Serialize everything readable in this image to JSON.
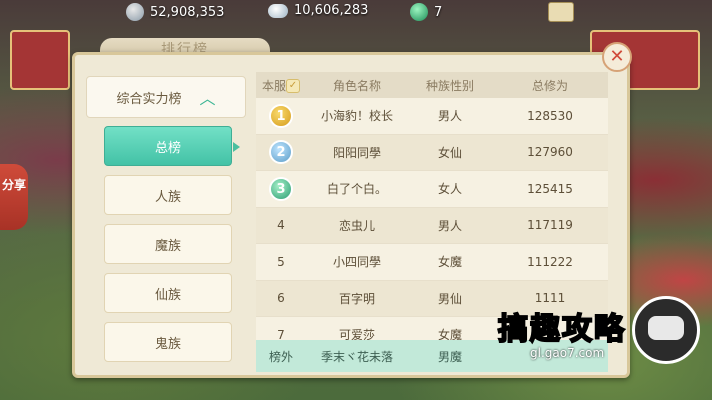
{
  "topbar": {
    "currency1": {
      "icon": "silver-coin-icon",
      "value": "52,908,353"
    },
    "currency2": {
      "icon": "cloud-coin-icon",
      "value": "10,606,283"
    },
    "currency3": {
      "icon": "jade-icon",
      "value": "7"
    },
    "gift_icon": "gift-box-icon"
  },
  "share": {
    "label": "分享"
  },
  "panel": {
    "title": "排行榜",
    "close_icon": "close-icon"
  },
  "sidebar": {
    "header": "综合实力榜",
    "header_icon": "chevron-up-icon",
    "items": [
      {
        "label": "总榜",
        "active": true
      },
      {
        "label": "人族",
        "active": false
      },
      {
        "label": "魔族",
        "active": false
      },
      {
        "label": "仙族",
        "active": false
      },
      {
        "label": "鬼族",
        "active": false
      }
    ]
  },
  "table": {
    "headers": [
      "本服",
      "角色名称",
      "种族性别",
      "总修为"
    ],
    "rows": [
      {
        "rank": "1",
        "medal": "gold",
        "name": "小海豹！校长",
        "race": "男人",
        "power": "128530"
      },
      {
        "rank": "2",
        "medal": "silver",
        "name": "阳阳同學",
        "race": "女仙",
        "power": "127960"
      },
      {
        "rank": "3",
        "medal": "bronze",
        "name": "白了个白。",
        "race": "女人",
        "power": "125415"
      },
      {
        "rank": "4",
        "medal": "",
        "name": "恋虫儿",
        "race": "男人",
        "power": "117119"
      },
      {
        "rank": "5",
        "medal": "",
        "name": "小四同學",
        "race": "女魔",
        "power": "111222"
      },
      {
        "rank": "6",
        "medal": "",
        "name": "百字明",
        "race": "男仙",
        "power": "1111"
      },
      {
        "rank": "7",
        "medal": "",
        "name": "可爱莎",
        "race": "女魔",
        "power": ""
      }
    ],
    "my_row": {
      "rank": "榜外",
      "name": "季末ヾ花未落",
      "race": "男魔",
      "power": ""
    }
  },
  "watermark": {
    "text": "搞趣攻略",
    "url": "gl.gao7.com",
    "icon": "gamepad-icon"
  },
  "colors": {
    "accent": "#43c2a6",
    "panel": "#efe9d6",
    "my_row": "#c2e9d9"
  }
}
